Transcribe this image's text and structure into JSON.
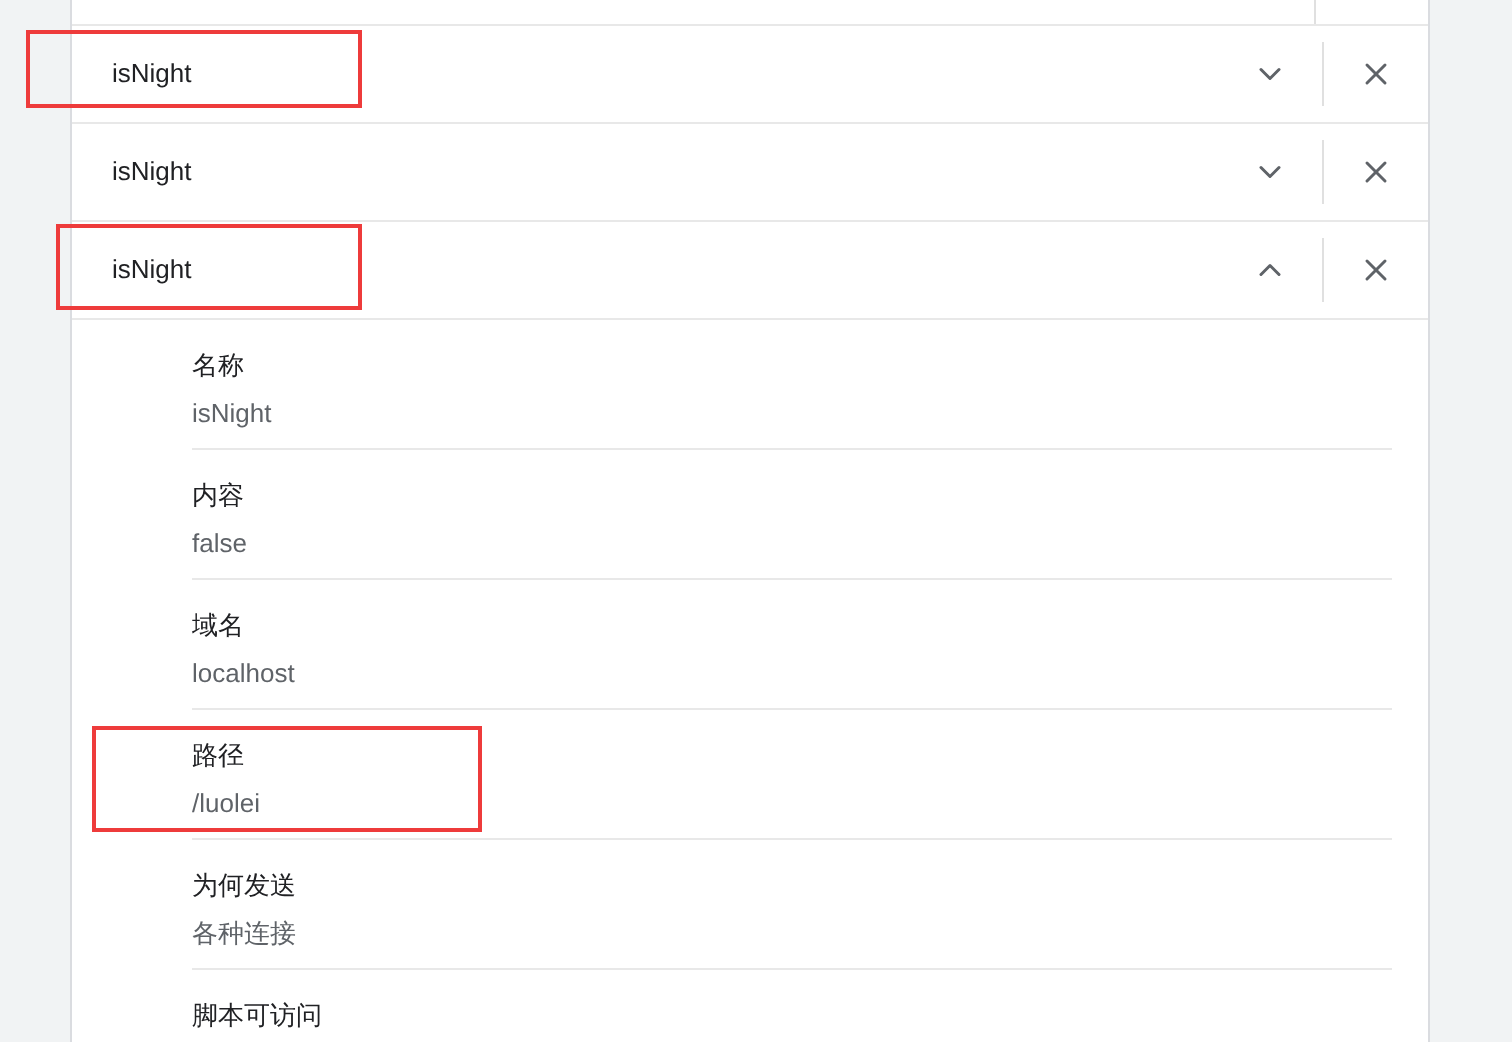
{
  "cookies": [
    {
      "name": "isNight",
      "expanded": false,
      "highlighted": true
    },
    {
      "name": "isNight",
      "expanded": false,
      "highlighted": false
    },
    {
      "name": "isNight",
      "expanded": true,
      "highlighted": true,
      "details": [
        {
          "label": "名称",
          "value": "isNight",
          "highlighted": false
        },
        {
          "label": "内容",
          "value": "false",
          "highlighted": false
        },
        {
          "label": "域名",
          "value": "localhost",
          "highlighted": false
        },
        {
          "label": "路径",
          "value": "/luolei",
          "highlighted": true
        },
        {
          "label": "为何发送",
          "value": "各种连接",
          "highlighted": false
        },
        {
          "label": "脚本可访问",
          "highlighted": false
        }
      ]
    }
  ]
}
